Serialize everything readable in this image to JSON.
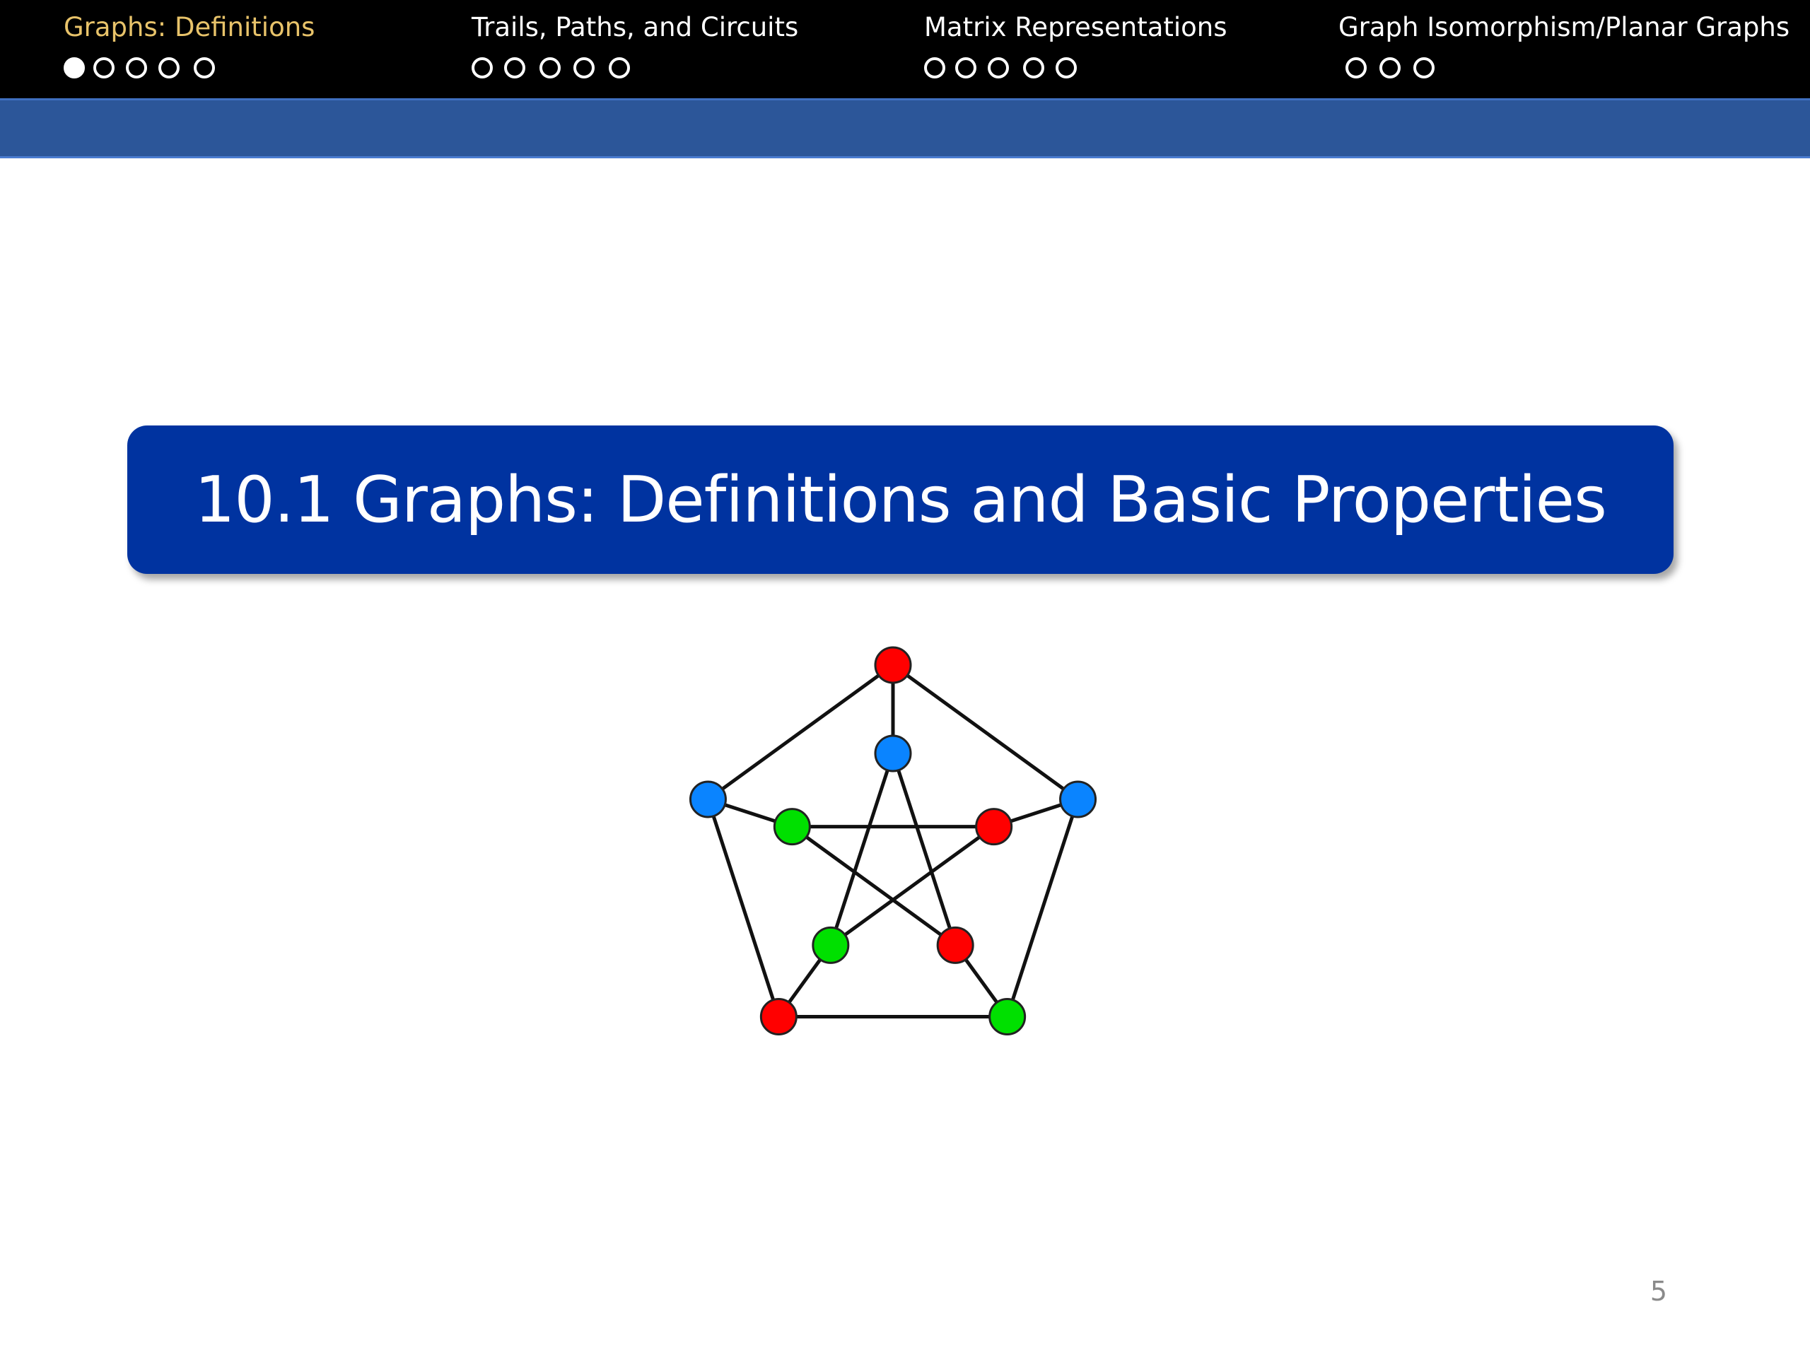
{
  "nav": {
    "sections": [
      {
        "label": "Graphs: Definitions",
        "dots": 5,
        "filled_index": 0,
        "active": true
      },
      {
        "label": "Trails, Paths, and Circuits",
        "dots": 5,
        "filled_index": -1,
        "active": false
      },
      {
        "label": "Matrix Representations",
        "dots": 5,
        "filled_index": -1,
        "active": false
      },
      {
        "label": "Graph Isomorphism/Planar Graphs",
        "dots": 3,
        "filled_index": -1,
        "active": false
      }
    ]
  },
  "title": {
    "text": "10.1 Graphs: Definitions and Basic Properties"
  },
  "graph": {
    "vertex_colors": {
      "red": "#ff0000",
      "blue": "#0a84ff",
      "green": "#00e000"
    },
    "outer_vertex_colors": [
      "red",
      "blue",
      "green",
      "red",
      "blue"
    ],
    "inner_vertex_colors": [
      "blue",
      "red",
      "red",
      "green",
      "green"
    ]
  },
  "footer": {
    "page_number": "5"
  }
}
